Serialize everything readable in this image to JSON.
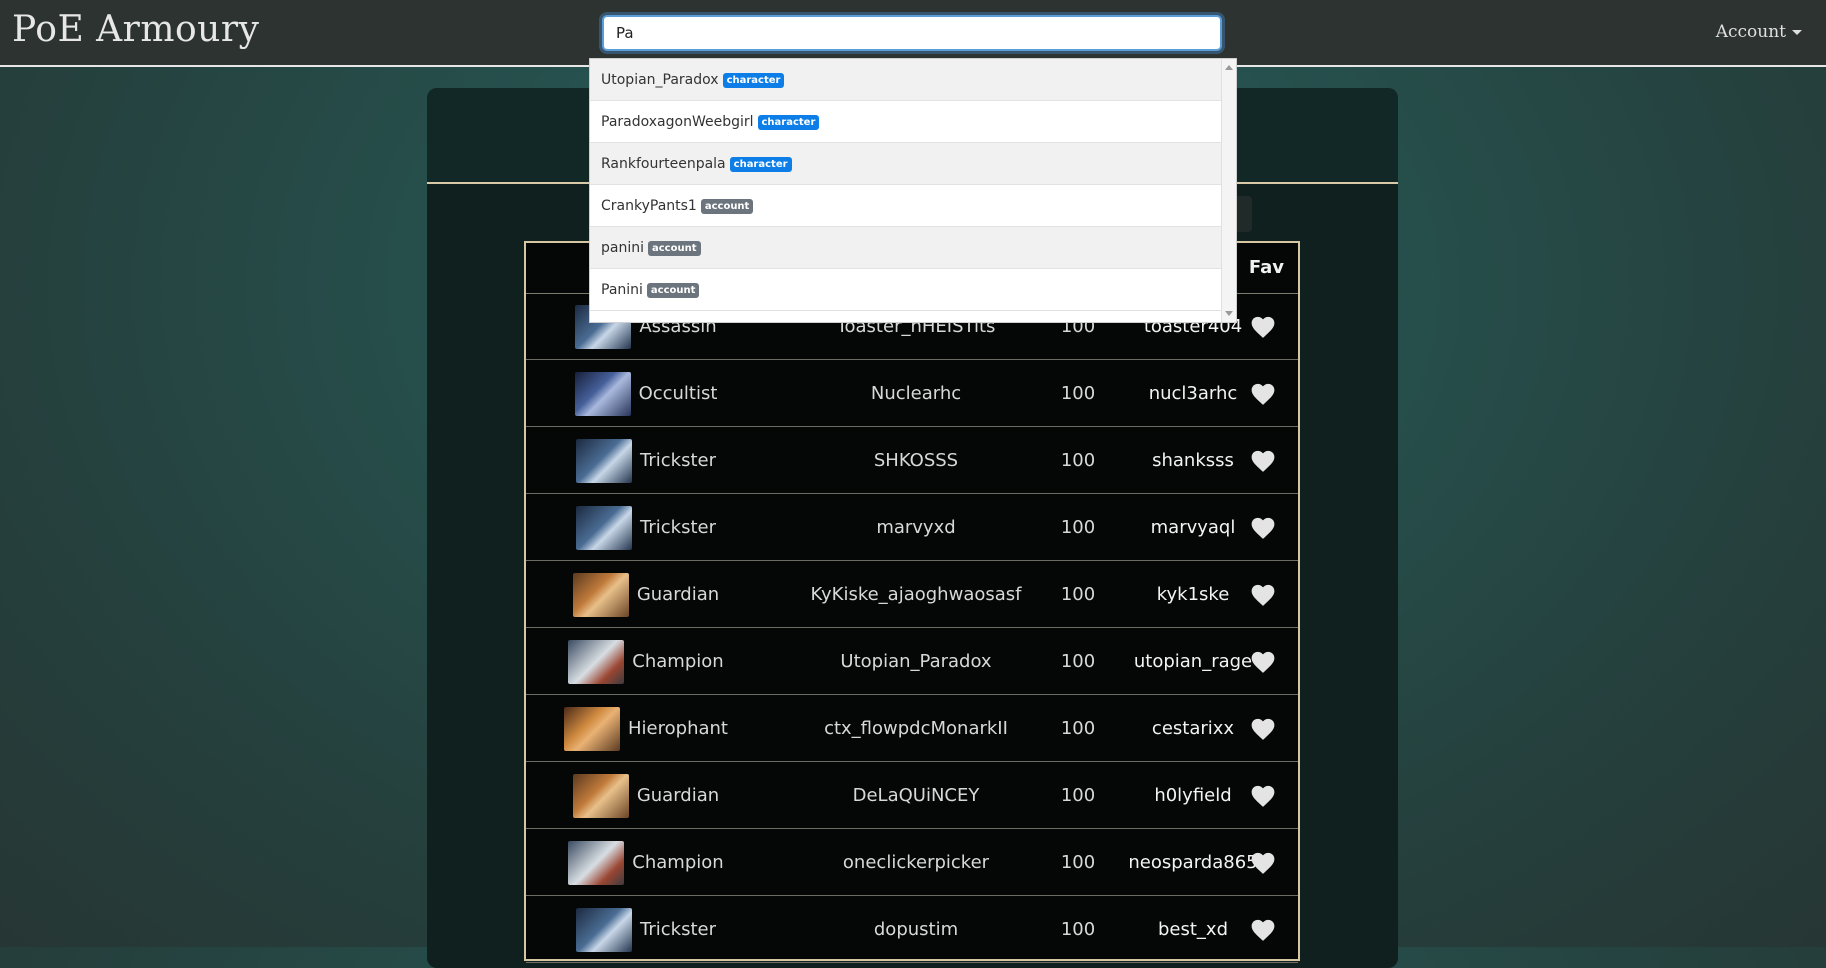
{
  "nav": {
    "brand": "PoE Armoury",
    "account_label": "Account"
  },
  "search": {
    "value": "Pa"
  },
  "suggestions": [
    {
      "name": "Utopian_Paradox",
      "type": "character"
    },
    {
      "name": "ParadoxagonWeebgirl",
      "type": "character"
    },
    {
      "name": "Rankfourteenpala",
      "type": "character"
    },
    {
      "name": "CrankyPants1",
      "type": "account"
    },
    {
      "name": "panini",
      "type": "account"
    },
    {
      "name": "Panini",
      "type": "account"
    }
  ],
  "badge_colors": {
    "character": "#0d7ee8",
    "account": "#6c757d"
  },
  "table": {
    "fav_header": "Fav",
    "rows": [
      {
        "class": "Assassin",
        "name": "Toaster_nHEISTits",
        "level": "100",
        "account": "toaster404",
        "avatar": "trickster"
      },
      {
        "class": "Occultist",
        "name": "Nuclearhc",
        "level": "100",
        "account": "nucl3arhc",
        "avatar": "occultist"
      },
      {
        "class": "Trickster",
        "name": "SHKOSSS",
        "level": "100",
        "account": "shanksss",
        "avatar": "trickster"
      },
      {
        "class": "Trickster",
        "name": "marvyxd",
        "level": "100",
        "account": "marvyaql",
        "avatar": "trickster"
      },
      {
        "class": "Guardian",
        "name": "KyKiske_ajaoghwaosasf",
        "level": "100",
        "account": "kyk1ske",
        "avatar": "guardian"
      },
      {
        "class": "Champion",
        "name": "Utopian_Paradox",
        "level": "100",
        "account": "utopian_rage",
        "avatar": "champion"
      },
      {
        "class": "Hierophant",
        "name": "ctx_flowpdcMonarkII",
        "level": "100",
        "account": "cestarixx",
        "avatar": "hierophant"
      },
      {
        "class": "Guardian",
        "name": "DeLaQUiNCEY",
        "level": "100",
        "account": "h0lyfield",
        "avatar": "guardian"
      },
      {
        "class": "Champion",
        "name": "oneclickerpicker",
        "level": "100",
        "account": "neosparda865",
        "avatar": "champion"
      },
      {
        "class": "Trickster",
        "name": "dopustim",
        "level": "100",
        "account": "best_xd",
        "avatar": "trickster"
      }
    ]
  }
}
